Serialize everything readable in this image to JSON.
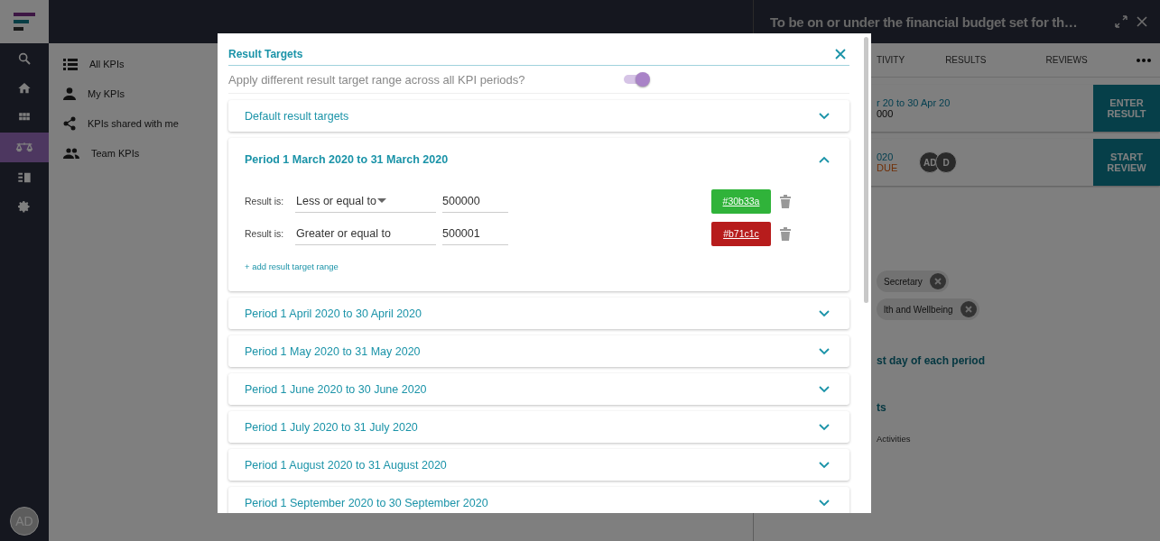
{
  "nav": [
    {
      "kind": "search",
      "selected": false
    },
    {
      "kind": "home",
      "selected": false
    },
    {
      "kind": "grid",
      "selected": false
    },
    {
      "kind": "scales",
      "selected": true
    },
    {
      "kind": "list",
      "selected": false
    },
    {
      "kind": "settings",
      "selected": false
    }
  ],
  "user_avatar": "AD",
  "menu": [
    {
      "label": "All KPIs",
      "kind": "list"
    },
    {
      "label": "My KPIs",
      "kind": "person"
    },
    {
      "label": "KPIs shared with me",
      "kind": "share"
    },
    {
      "label": "Team KPIs",
      "kind": "people"
    }
  ],
  "detail_panel": {
    "title": "To be on or under the financial budget set for th…",
    "tabs": [
      "TIVITY",
      "RESULTS",
      "REVIEWS"
    ],
    "rows": [
      {
        "line_1": "r 20 to 30 Apr 20",
        "line_2": "000",
        "action": "ENTER RESULT"
      },
      {
        "line_1": "020",
        "status": "DUE",
        "avatars": [
          "AD",
          "D"
        ],
        "action": "START REVIEW"
      }
    ],
    "chips": [
      "Secretary",
      "lth and Wellbeing"
    ],
    "heading_1": "st day of each period",
    "heading_2": "ts",
    "field_label": "Activities"
  },
  "dialog": {
    "title": "Result Targets",
    "toggle": {
      "label": "Apply different result target range across all KPI periods?",
      "on": true
    },
    "sections": [
      {
        "title": "Default result targets",
        "expanded": false
      },
      {
        "title": "Period 1 March 2020 to 31 March 2020",
        "expanded": true,
        "ranges": [
          {
            "label": "Result is:",
            "operator": "Less or equal to",
            "value": "500000",
            "color": "#30b33a",
            "color_label": "#30b33a"
          },
          {
            "label": "Result is:",
            "operator": "Greater or equal to",
            "value": "500001",
            "color": "#b71c1c",
            "color_label": "#b71c1c"
          }
        ],
        "add_link": "+ add result target range"
      },
      {
        "title": "Period 1 April 2020 to 30 April 2020",
        "expanded": false
      },
      {
        "title": "Period 1 May 2020 to 31 May 2020",
        "expanded": false
      },
      {
        "title": "Period 1 June 2020 to 30 June 2020",
        "expanded": false
      },
      {
        "title": "Period 1 July 2020 to 31 July 2020",
        "expanded": false
      },
      {
        "title": "Period 1 August 2020 to 31 August 2020",
        "expanded": false
      },
      {
        "title": "Period 1 September 2020 to 30 September 2020",
        "expanded": false
      }
    ]
  }
}
